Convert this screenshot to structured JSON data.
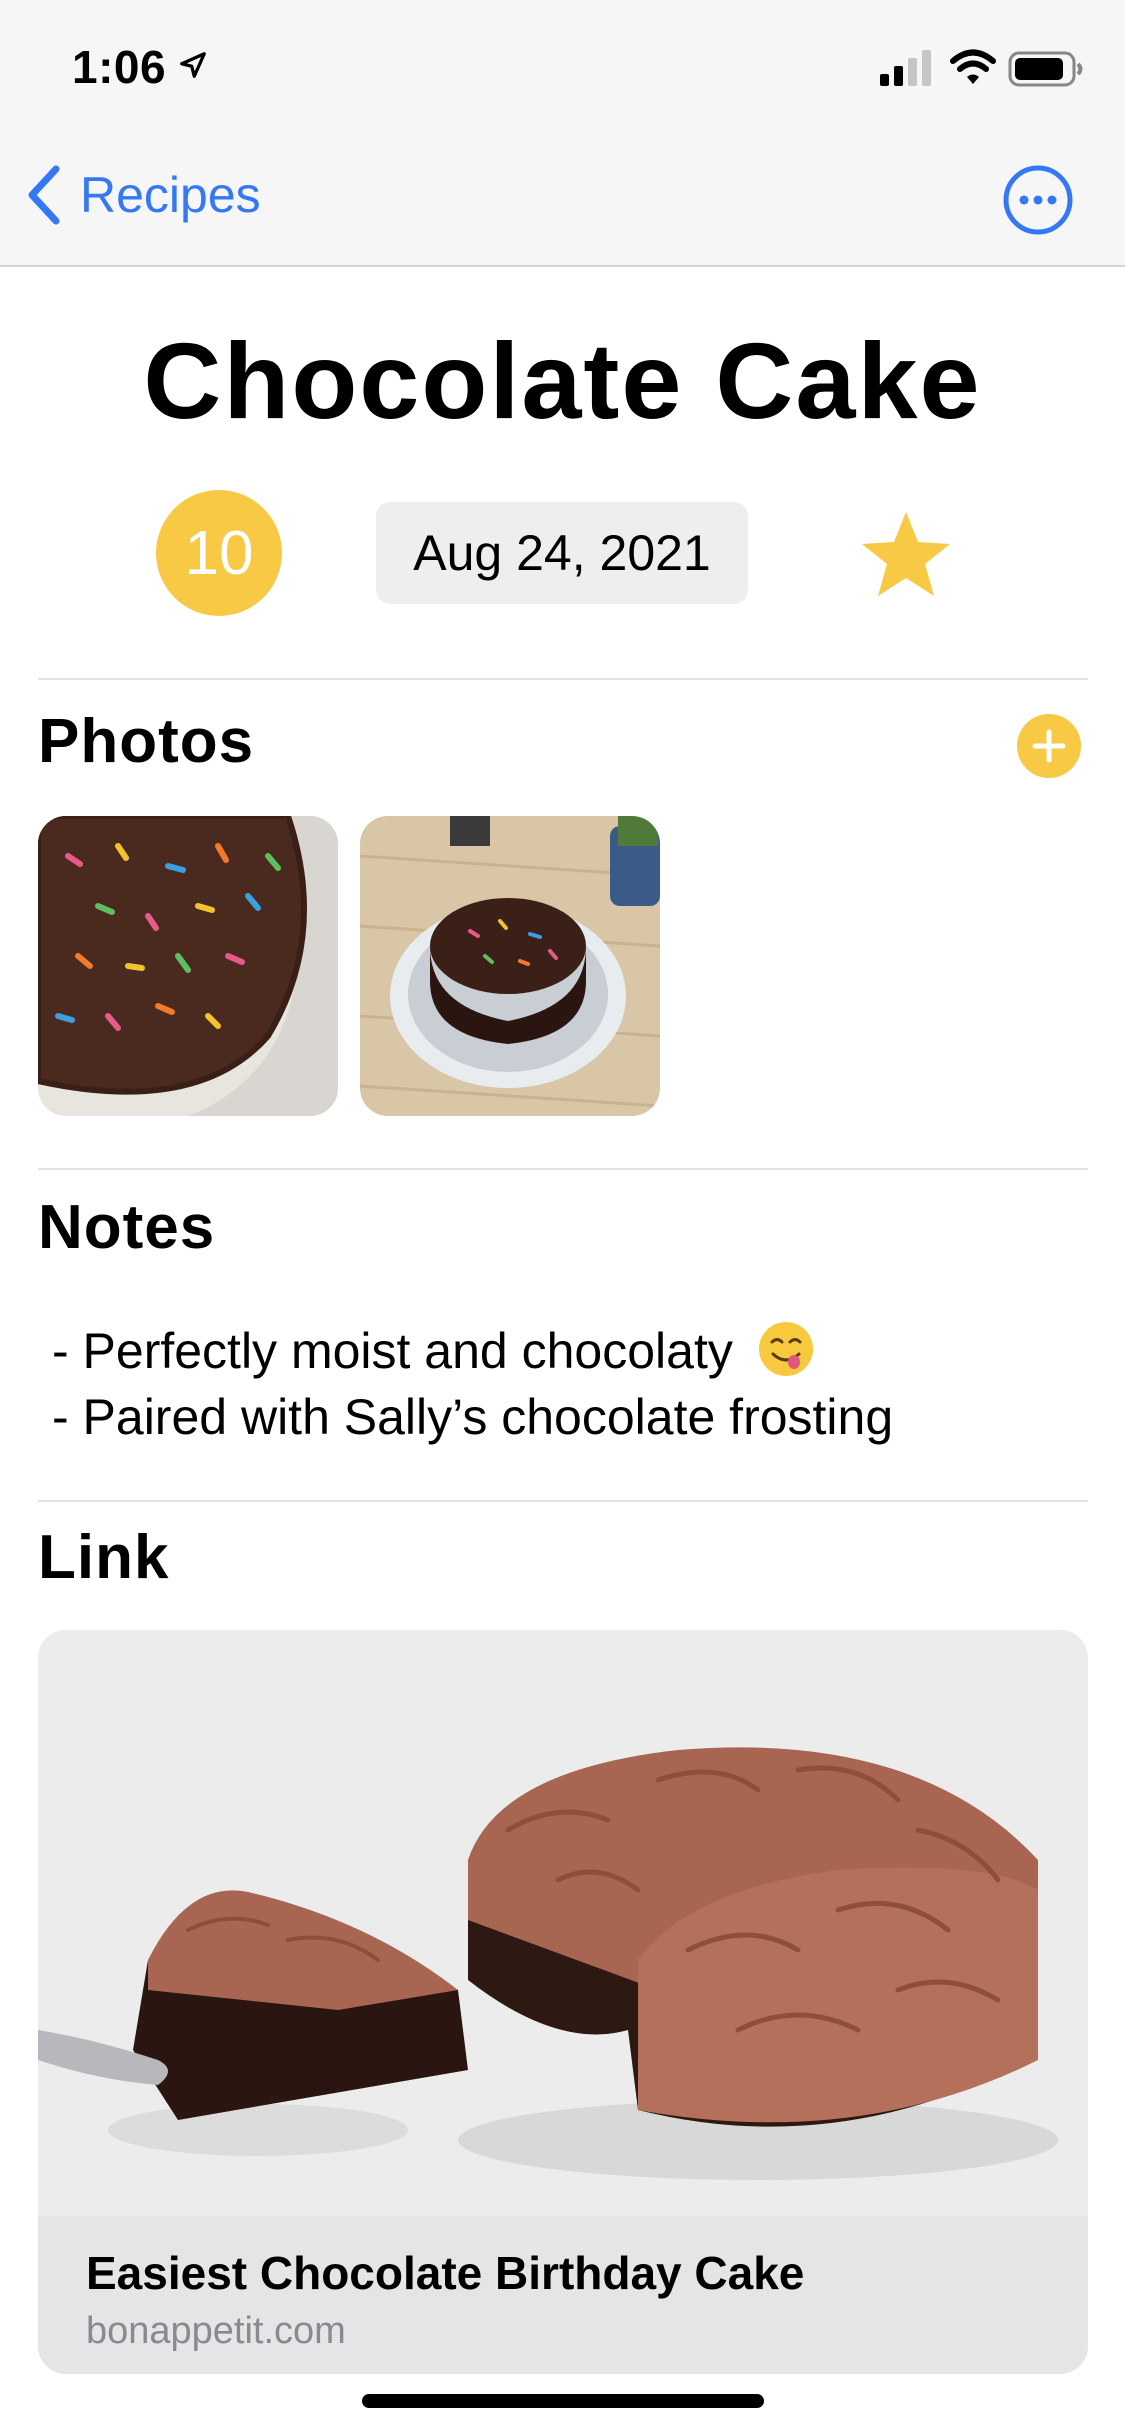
{
  "status_bar": {
    "time": "1:06"
  },
  "nav": {
    "back_label": "Recipes"
  },
  "recipe": {
    "title": "Chocolate Cake",
    "rating": "10",
    "date": "Aug 24, 2021",
    "favorite": true
  },
  "sections": {
    "photos_title": "Photos",
    "notes_title": "Notes",
    "link_title": "Link"
  },
  "notes": {
    "line1": "- Perfectly moist and chocolaty",
    "line2": "- Paired with Sally’s chocolate frosting"
  },
  "link": {
    "title": "Easiest Chocolate Birthday Cake",
    "domain": "bonappetit.com"
  },
  "colors": {
    "accent_blue": "#3478f6",
    "accent_yellow": "#f7c944"
  },
  "icons": [
    "location-arrow-icon",
    "cellular-signal-icon",
    "wifi-icon",
    "battery-icon",
    "chevron-left-icon",
    "ellipsis-circle-icon",
    "star-icon",
    "plus-circle-icon",
    "face-savoring-food-emoji"
  ]
}
